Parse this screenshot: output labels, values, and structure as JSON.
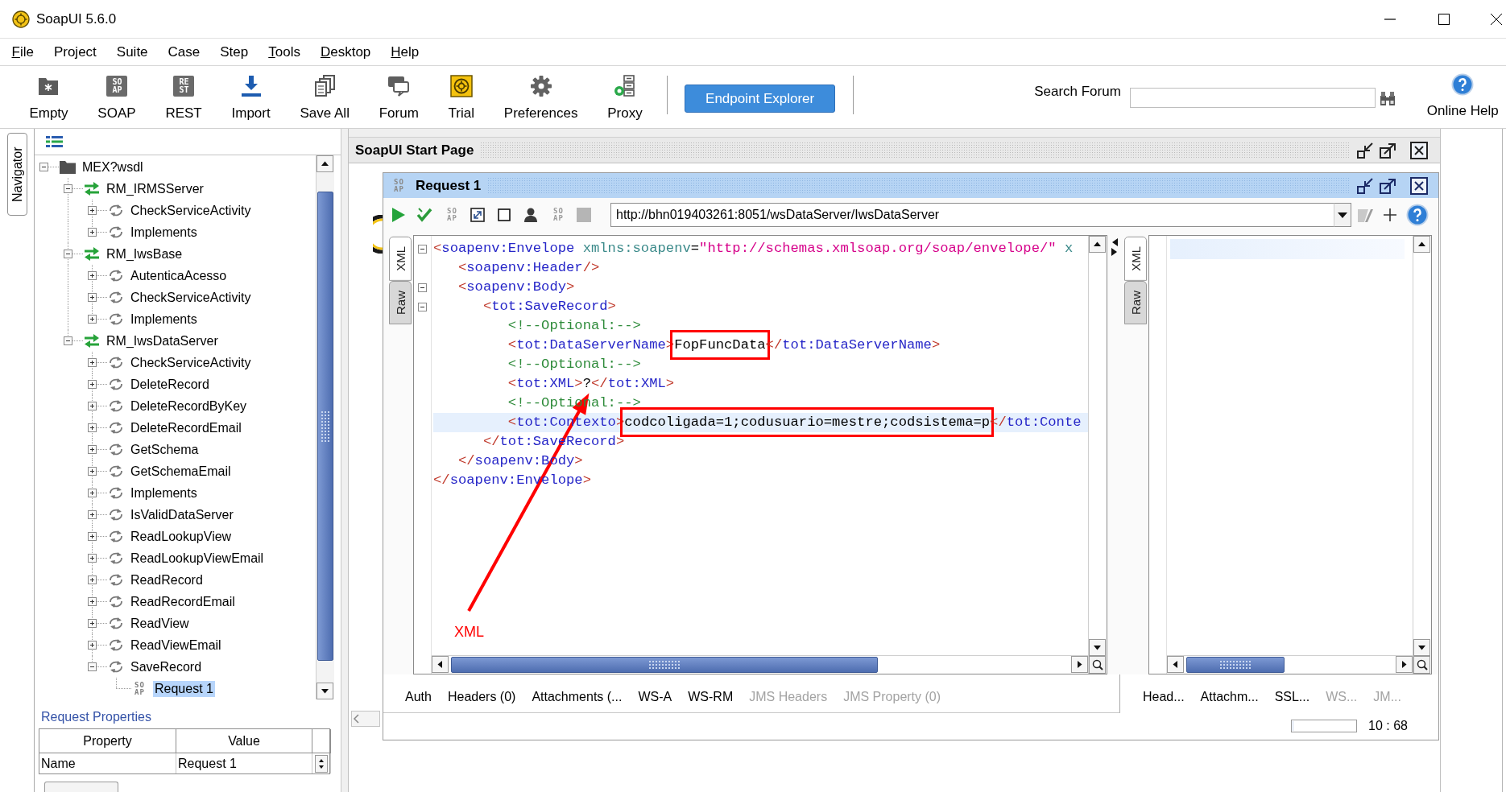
{
  "window": {
    "title": "SoapUI 5.6.0"
  },
  "menu": [
    {
      "label": "File",
      "mnemonic": true
    },
    {
      "label": "Project",
      "mnemonic": false
    },
    {
      "label": "Suite",
      "mnemonic": false
    },
    {
      "label": "Case",
      "mnemonic": false
    },
    {
      "label": "Step",
      "mnemonic": false
    },
    {
      "label": "Tools",
      "mnemonic": true
    },
    {
      "label": "Desktop",
      "mnemonic": true
    },
    {
      "label": "Help",
      "mnemonic": true
    }
  ],
  "toolbar": {
    "buttons": [
      {
        "kind": "empty",
        "label": "Empty"
      },
      {
        "kind": "soap",
        "label": "SOAP",
        "icon_label": "SOAP"
      },
      {
        "kind": "rest",
        "label": "REST",
        "icon_label": "REST"
      },
      {
        "kind": "import",
        "label": "Import"
      },
      {
        "kind": "save_all",
        "label": "Save All"
      },
      {
        "kind": "forum",
        "label": "Forum"
      },
      {
        "kind": "trial",
        "label": "Trial"
      },
      {
        "kind": "preferences",
        "label": "Preferences"
      },
      {
        "kind": "proxy",
        "label": "Proxy"
      }
    ],
    "endpoint_explorer": "Endpoint Explorer",
    "search": {
      "label": "Search Forum"
    },
    "online_help": "Online Help"
  },
  "navigator": {
    "tab": "Navigator",
    "tree": [
      {
        "kind": "project",
        "label": "MEX?wsdl",
        "expanded": true,
        "selected": false,
        "children": [
          {
            "kind": "interface",
            "label": "RM_IRMSServer",
            "expanded": true,
            "selected": false,
            "children": [
              {
                "kind": "operation",
                "label": "CheckServiceActivity",
                "expanded": false,
                "selected": false
              },
              {
                "kind": "operation",
                "label": "Implements",
                "expanded": false,
                "selected": false
              }
            ]
          },
          {
            "kind": "interface",
            "label": "RM_IwsBase",
            "expanded": true,
            "selected": false,
            "children": [
              {
                "kind": "operation",
                "label": "AutenticaAcesso",
                "expanded": false,
                "selected": false
              },
              {
                "kind": "operation",
                "label": "CheckServiceActivity",
                "expanded": false,
                "selected": false
              },
              {
                "kind": "operation",
                "label": "Implements",
                "expanded": false,
                "selected": false
              }
            ]
          },
          {
            "kind": "interface",
            "label": "RM_IwsDataServer",
            "expanded": true,
            "selected": false,
            "children": [
              {
                "kind": "operation",
                "label": "CheckServiceActivity",
                "expanded": false,
                "selected": false
              },
              {
                "kind": "operation",
                "label": "DeleteRecord",
                "expanded": false,
                "selected": false
              },
              {
                "kind": "operation",
                "label": "DeleteRecordByKey",
                "expanded": false,
                "selected": false
              },
              {
                "kind": "operation",
                "label": "DeleteRecordEmail",
                "expanded": false,
                "selected": false
              },
              {
                "kind": "operation",
                "label": "GetSchema",
                "expanded": false,
                "selected": false
              },
              {
                "kind": "operation",
                "label": "GetSchemaEmail",
                "expanded": false,
                "selected": false
              },
              {
                "kind": "operation",
                "label": "Implements",
                "expanded": false,
                "selected": false
              },
              {
                "kind": "operation",
                "label": "IsValidDataServer",
                "expanded": false,
                "selected": false
              },
              {
                "kind": "operation",
                "label": "ReadLookupView",
                "expanded": false,
                "selected": false
              },
              {
                "kind": "operation",
                "label": "ReadLookupViewEmail",
                "expanded": false,
                "selected": false
              },
              {
                "kind": "operation",
                "label": "ReadRecord",
                "expanded": false,
                "selected": false
              },
              {
                "kind": "operation",
                "label": "ReadRecordEmail",
                "expanded": false,
                "selected": false
              },
              {
                "kind": "operation",
                "label": "ReadView",
                "expanded": false,
                "selected": false
              },
              {
                "kind": "operation",
                "label": "ReadViewEmail",
                "expanded": false,
                "selected": false
              },
              {
                "kind": "operation",
                "label": "SaveRecord",
                "expanded": true,
                "selected": false,
                "children": [
                  {
                    "kind": "request",
                    "label": "Request 1",
                    "icon_label": "SOAP",
                    "selected": true
                  }
                ]
              }
            ]
          }
        ]
      }
    ],
    "properties": {
      "title": "Request Properties",
      "columns": [
        "Property",
        "Value"
      ],
      "rows": [
        [
          "Name",
          "Request 1"
        ]
      ]
    }
  },
  "start_page": {
    "title": "SoapUI Start Page"
  },
  "request": {
    "title": "Request 1",
    "icon_label": "SOAP",
    "toolbar": [
      {
        "kind": "run"
      },
      {
        "kind": "validate"
      },
      {
        "kind": "soap",
        "icon_label": "SOAP"
      },
      {
        "kind": "frame"
      },
      {
        "kind": "square"
      },
      {
        "kind": "user"
      },
      {
        "kind": "soap",
        "icon_label": "SOAP"
      },
      {
        "kind": "cancel"
      }
    ],
    "url": "http://bhn019403261:8051/wsDataServer/IwsDataServer",
    "tools": [
      {
        "kind": "tool"
      },
      {
        "kind": "plus"
      },
      {
        "kind": "help"
      }
    ],
    "editor": {
      "tabs": [
        {
          "label": "XML",
          "selected": true
        },
        {
          "label": "Raw",
          "selected": false
        }
      ],
      "lines": [
        {
          "fold": true,
          "current": false,
          "tokens": [
            {
              "kind": "bracket",
              "text": "<"
            },
            {
              "kind": "tag",
              "text": "soapenv:Envelope"
            },
            {
              "kind": "attr",
              "text": " xmlns:soapenv"
            },
            {
              "kind": "eq",
              "text": "="
            },
            {
              "kind": "string",
              "text": "\"http://schemas.xmlsoap.org/soap/envelope/\""
            },
            {
              "kind": "attr",
              "text": " x"
            }
          ]
        },
        {
          "fold": false,
          "current": false,
          "tokens": [
            {
              "kind": "bracket",
              "text": "   <"
            },
            {
              "kind": "tag",
              "text": "soapenv:Header"
            },
            {
              "kind": "bracket",
              "text": "/>"
            }
          ]
        },
        {
          "fold": true,
          "current": false,
          "tokens": [
            {
              "kind": "bracket",
              "text": "   <"
            },
            {
              "kind": "tag",
              "text": "soapenv:Body"
            },
            {
              "kind": "bracket",
              "text": ">"
            }
          ]
        },
        {
          "fold": true,
          "current": false,
          "tokens": [
            {
              "kind": "bracket",
              "text": "      <"
            },
            {
              "kind": "tag",
              "text": "tot:SaveRecord"
            },
            {
              "kind": "bracket",
              "text": ">"
            }
          ]
        },
        {
          "fold": false,
          "current": false,
          "tokens": [
            {
              "kind": "comment",
              "text": "         <!--Optional:-->"
            }
          ]
        },
        {
          "fold": false,
          "current": false,
          "tokens": [
            {
              "kind": "bracket",
              "text": "         <"
            },
            {
              "kind": "tag",
              "text": "tot:DataServerName"
            },
            {
              "kind": "bracket",
              "text": ">"
            },
            {
              "kind": "text",
              "text": "FopFuncData",
              "boxed": true
            },
            {
              "kind": "bracket",
              "text": "</"
            },
            {
              "kind": "tag",
              "text": "tot:DataServerName"
            },
            {
              "kind": "bracket",
              "text": ">"
            }
          ]
        },
        {
          "fold": false,
          "current": false,
          "tokens": [
            {
              "kind": "comment",
              "text": "         <!--Optional:-->"
            }
          ]
        },
        {
          "fold": false,
          "current": false,
          "tokens": [
            {
              "kind": "bracket",
              "text": "         <"
            },
            {
              "kind": "tag",
              "text": "tot:XML"
            },
            {
              "kind": "bracket",
              "text": ">"
            },
            {
              "kind": "text",
              "text": "?",
              "boxed": false
            },
            {
              "kind": "bracket",
              "text": "</"
            },
            {
              "kind": "tag",
              "text": "tot:XML"
            },
            {
              "kind": "bracket",
              "text": ">"
            }
          ]
        },
        {
          "fold": false,
          "current": false,
          "tokens": [
            {
              "kind": "comment",
              "text": "         <!--Optional:-->"
            }
          ]
        },
        {
          "fold": false,
          "current": true,
          "tokens": [
            {
              "kind": "bracket",
              "text": "         <"
            },
            {
              "kind": "tag",
              "text": "tot:Contexto"
            },
            {
              "kind": "bracket",
              "text": ">"
            },
            {
              "kind": "text",
              "text": "codcoligada=1;codusuario=mestre;codsistema=p",
              "boxed": true
            },
            {
              "kind": "bracket",
              "text": "</"
            },
            {
              "kind": "tag",
              "text": "tot:Conte"
            }
          ]
        },
        {
          "fold": false,
          "current": false,
          "tokens": [
            {
              "kind": "bracket",
              "text": "      </"
            },
            {
              "kind": "tag",
              "text": "tot:SaveRecord"
            },
            {
              "kind": "bracket",
              "text": ">"
            }
          ]
        },
        {
          "fold": false,
          "current": false,
          "tokens": [
            {
              "kind": "bracket",
              "text": "   </"
            },
            {
              "kind": "tag",
              "text": "soapenv:Body"
            },
            {
              "kind": "bracket",
              "text": ">"
            }
          ]
        },
        {
          "fold": false,
          "current": false,
          "tokens": [
            {
              "kind": "bracket",
              "text": "</"
            },
            {
              "kind": "tag",
              "text": "soapenv:Envelope"
            },
            {
              "kind": "bracket",
              "text": ">"
            }
          ]
        }
      ],
      "annotation": {
        "label": "XML"
      }
    },
    "response": {
      "tabs": [
        {
          "label": "XML",
          "selected": true
        },
        {
          "label": "Raw",
          "selected": false
        }
      ]
    },
    "request_tabs": [
      {
        "label": "Auth",
        "disabled": false
      },
      {
        "label": "Headers (0)",
        "disabled": false
      },
      {
        "label": "Attachments (...",
        "disabled": false
      },
      {
        "label": "WS-A",
        "disabled": false
      },
      {
        "label": "WS-RM",
        "disabled": false
      },
      {
        "label": "JMS Headers",
        "disabled": true
      },
      {
        "label": "JMS Property (0)",
        "disabled": true
      }
    ],
    "response_tabs": [
      {
        "label": "Head...",
        "disabled": false
      },
      {
        "label": "Attachm...",
        "disabled": false
      },
      {
        "label": "SSL...",
        "disabled": false
      },
      {
        "label": "WS...",
        "disabled": true
      },
      {
        "label": "JM...",
        "disabled": true
      }
    ],
    "progress": {
      "level": 0
    },
    "caret": "10 : 68"
  }
}
